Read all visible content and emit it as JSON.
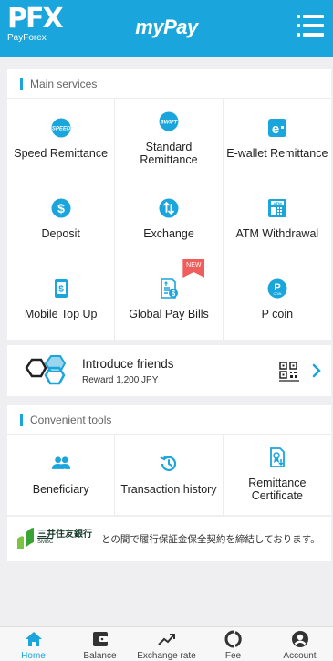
{
  "header": {
    "logo_mark": "PFX",
    "logo_text": "PayForex",
    "title": "myPay"
  },
  "main_services": {
    "title": "Main services",
    "items": [
      {
        "label": "Speed Remittance",
        "icon": "speed-icon",
        "icon_text": "SPEED"
      },
      {
        "label": "Standard Remittance",
        "icon": "swift-icon",
        "icon_text": "SWIFT"
      },
      {
        "label": "E-wallet Remittance",
        "icon": "ewallet-icon",
        "icon_text": "e"
      },
      {
        "label": "Deposit",
        "icon": "dollar-icon"
      },
      {
        "label": "Exchange",
        "icon": "exchange-icon"
      },
      {
        "label": "ATM Withdrawal",
        "icon": "atm-icon",
        "icon_text": "ATM"
      },
      {
        "label": "Mobile Top Up",
        "icon": "mobile-topup-icon"
      },
      {
        "label": "Global Pay Bills",
        "icon": "bill-icon",
        "badge": "NEW"
      },
      {
        "label": "P coin",
        "icon": "pcoin-icon",
        "icon_text": "COIN"
      }
    ]
  },
  "introduce": {
    "title": "Introduce friends",
    "subtitle": "Reward 1,200 JPY"
  },
  "convenient_tools": {
    "title": "Convenient tools",
    "items": [
      {
        "label": "Beneficiary",
        "icon": "people-icon"
      },
      {
        "label": "Transaction history",
        "icon": "history-icon"
      },
      {
        "label": "Remittance Certificate",
        "icon": "certificate-icon"
      }
    ]
  },
  "bank_notice": {
    "bank_name": "三井住友銀行",
    "bank_sub": "SMBC",
    "message": "との間で履行保証金保全契約を締結しております。"
  },
  "tabbar": {
    "items": [
      {
        "label": "Home",
        "icon": "home-icon",
        "active": true
      },
      {
        "label": "Balance",
        "icon": "wallet-icon"
      },
      {
        "label": "Exchange rate",
        "icon": "trend-icon"
      },
      {
        "label": "Fee",
        "icon": "fee-icon"
      },
      {
        "label": "Account",
        "icon": "account-icon"
      }
    ]
  },
  "colors": {
    "brand": "#1aa6dc",
    "badge": "#ef5d5d",
    "bank_green": "#7dc242"
  }
}
